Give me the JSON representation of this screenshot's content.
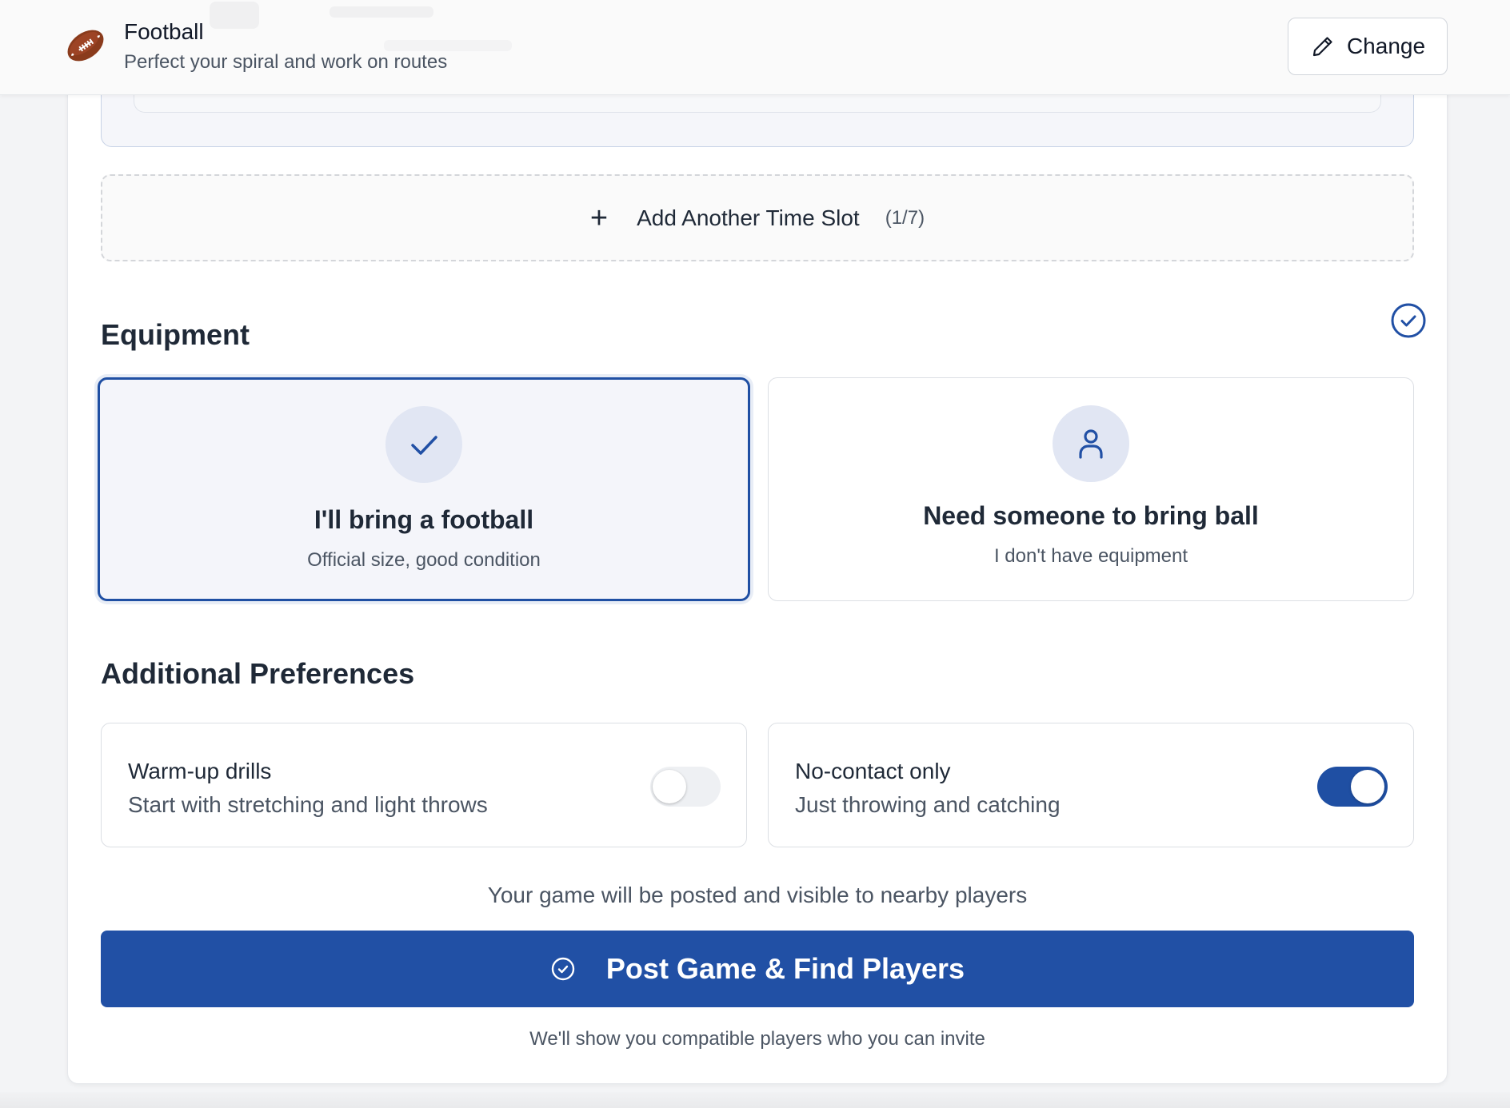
{
  "header": {
    "sport_icon": "football-icon",
    "title": "Football",
    "subtitle": "Perfect your spiral and work on routes",
    "change_label": "Change",
    "change_icon": "pencil-icon"
  },
  "time_slots": {
    "add_label": "Add Another Time Slot",
    "count": "(1/7)"
  },
  "equipment": {
    "title": "Equipment",
    "status_icon": "check-circle-icon",
    "options": [
      {
        "label": "I'll bring a football",
        "description": "Official size, good condition",
        "icon": "check-icon",
        "selected": true
      },
      {
        "label": "Need someone to bring ball",
        "description": "I don't have equipment",
        "icon": "user-icon",
        "selected": false
      }
    ]
  },
  "preferences": {
    "title": "Additional Preferences",
    "items": [
      {
        "title": "Warm-up drills",
        "description": "Start with stretching and light throws",
        "enabled": false
      },
      {
        "title": "No-contact only",
        "description": "Just throwing and catching",
        "enabled": true
      }
    ]
  },
  "submit": {
    "notice": "Your game will be posted and visible to nearby players",
    "button_label": "Post Game & Find Players",
    "button_icon": "check-circle-icon",
    "footnote": "We'll show you compatible players who you can invite"
  },
  "colors": {
    "accent": "#2150a5",
    "accent_light": "#e1e6f3",
    "text": "#1f2937",
    "muted": "#4b5563"
  }
}
